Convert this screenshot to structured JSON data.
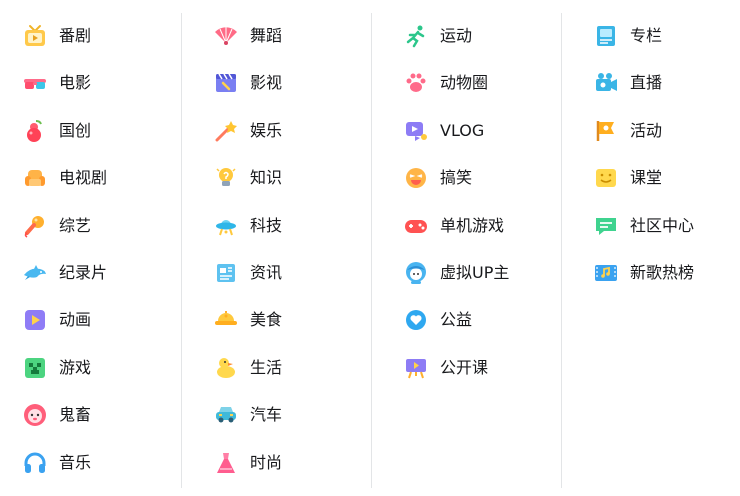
{
  "columns": [
    {
      "items": [
        {
          "label": "番剧",
          "icon": "tv-icon"
        },
        {
          "label": "电影",
          "icon": "3d-glasses-icon"
        },
        {
          "label": "国创",
          "icon": "gourd-icon"
        },
        {
          "label": "电视剧",
          "icon": "sofa-icon"
        },
        {
          "label": "综艺",
          "icon": "microphone-icon"
        },
        {
          "label": "纪录片",
          "icon": "dolphin-icon"
        },
        {
          "label": "动画",
          "icon": "play-icon"
        },
        {
          "label": "游戏",
          "icon": "creeper-icon"
        },
        {
          "label": "鬼畜",
          "icon": "lion-face-icon"
        },
        {
          "label": "音乐",
          "icon": "headphones-icon"
        }
      ]
    },
    {
      "items": [
        {
          "label": "舞蹈",
          "icon": "fan-icon"
        },
        {
          "label": "影视",
          "icon": "clapper-icon"
        },
        {
          "label": "娱乐",
          "icon": "magic-wand-icon"
        },
        {
          "label": "知识",
          "icon": "lightbulb-icon"
        },
        {
          "label": "科技",
          "icon": "ufo-icon"
        },
        {
          "label": "资讯",
          "icon": "newspaper-icon"
        },
        {
          "label": "美食",
          "icon": "food-icon"
        },
        {
          "label": "生活",
          "icon": "duck-icon"
        },
        {
          "label": "汽车",
          "icon": "car-icon"
        },
        {
          "label": "时尚",
          "icon": "dress-icon"
        }
      ]
    },
    {
      "items": [
        {
          "label": "运动",
          "icon": "runner-icon"
        },
        {
          "label": "动物圈",
          "icon": "paw-icon"
        },
        {
          "label": "VLOG",
          "icon": "vlog-icon"
        },
        {
          "label": "搞笑",
          "icon": "laughing-face-icon"
        },
        {
          "label": "单机游戏",
          "icon": "gamepad-icon"
        },
        {
          "label": "虚拟UP主",
          "icon": "virtual-avatar-icon"
        },
        {
          "label": "公益",
          "icon": "charity-heart-icon"
        },
        {
          "label": "公开课",
          "icon": "lecture-board-icon"
        }
      ]
    },
    {
      "items": [
        {
          "label": "专栏",
          "icon": "book-icon"
        },
        {
          "label": "直播",
          "icon": "camera-icon"
        },
        {
          "label": "活动",
          "icon": "flag-icon"
        },
        {
          "label": "课堂",
          "icon": "classroom-icon"
        },
        {
          "label": "社区中心",
          "icon": "chat-bubble-icon"
        },
        {
          "label": "新歌热榜",
          "icon": "music-film-icon"
        }
      ]
    }
  ]
}
